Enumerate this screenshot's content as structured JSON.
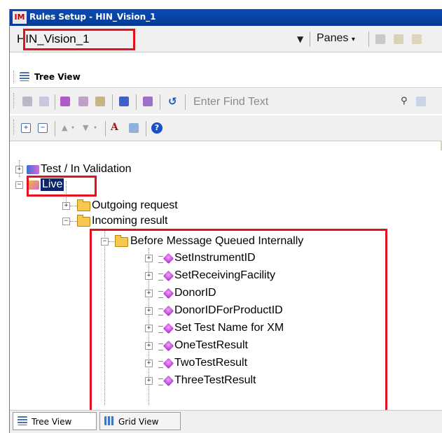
{
  "window": {
    "title": "Rules Setup - HIN_Vision_1",
    "app_icon": "IM"
  },
  "selector": {
    "value": "HIN_Vision_1",
    "panes_label": "Panes"
  },
  "tree_view_header": "Tree View",
  "toolbar": {
    "find_placeholder": "Enter Find Text"
  },
  "tree": {
    "root_items": [
      {
        "label": "Test / In Validation"
      },
      {
        "label": "Live"
      }
    ],
    "live_children": [
      {
        "label": "Outgoing request"
      },
      {
        "label": "Incoming result"
      }
    ],
    "incoming_children": [
      {
        "label": "Before Message Queued Internally"
      }
    ],
    "rules": [
      {
        "label": "SetInstrumentID"
      },
      {
        "label": "SetReceivingFacility"
      },
      {
        "label": "DonorID"
      },
      {
        "label": "DonorIDForProductID"
      },
      {
        "label": "Set Test Name for XM"
      },
      {
        "label": "OneTestResult"
      },
      {
        "label": "TwoTestResult"
      },
      {
        "label": "ThreeTestResult"
      }
    ]
  },
  "bottom_tabs": [
    {
      "label": "Tree View"
    },
    {
      "label": "Grid View"
    }
  ],
  "colors": {
    "title_bar": "#063a93",
    "highlight_box": "#e4101e",
    "folder": "#f6c94e",
    "rule_icon": "#a020c0"
  }
}
